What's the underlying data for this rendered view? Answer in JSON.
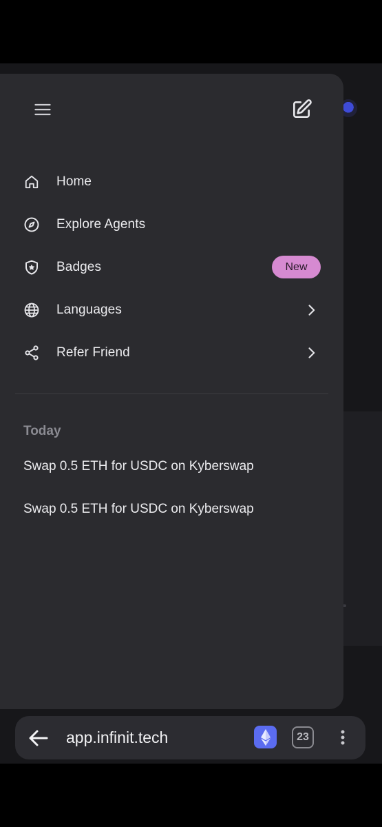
{
  "sidebar": {
    "nav": [
      {
        "label": "Home",
        "icon": "home-icon"
      },
      {
        "label": "Explore Agents",
        "icon": "compass-icon"
      },
      {
        "label": "Badges",
        "icon": "shield-star-icon",
        "badge": "New"
      },
      {
        "label": "Languages",
        "icon": "globe-icon",
        "chevron": true
      },
      {
        "label": "Refer Friend",
        "icon": "share-icon",
        "chevron": true
      }
    ],
    "history": {
      "section_title": "Today",
      "items": [
        "Swap 0.5 ETH for USDC on Kyberswap",
        "Swap 0.5 ETH for USDC on Kyberswap"
      ]
    }
  },
  "browser": {
    "url": "app.infinit.tech",
    "tab_count": "23"
  },
  "colors": {
    "drawer_bg": "#2b2b2f",
    "badge_bg": "#d68ad1",
    "eth_button": "#5b6cf0"
  }
}
